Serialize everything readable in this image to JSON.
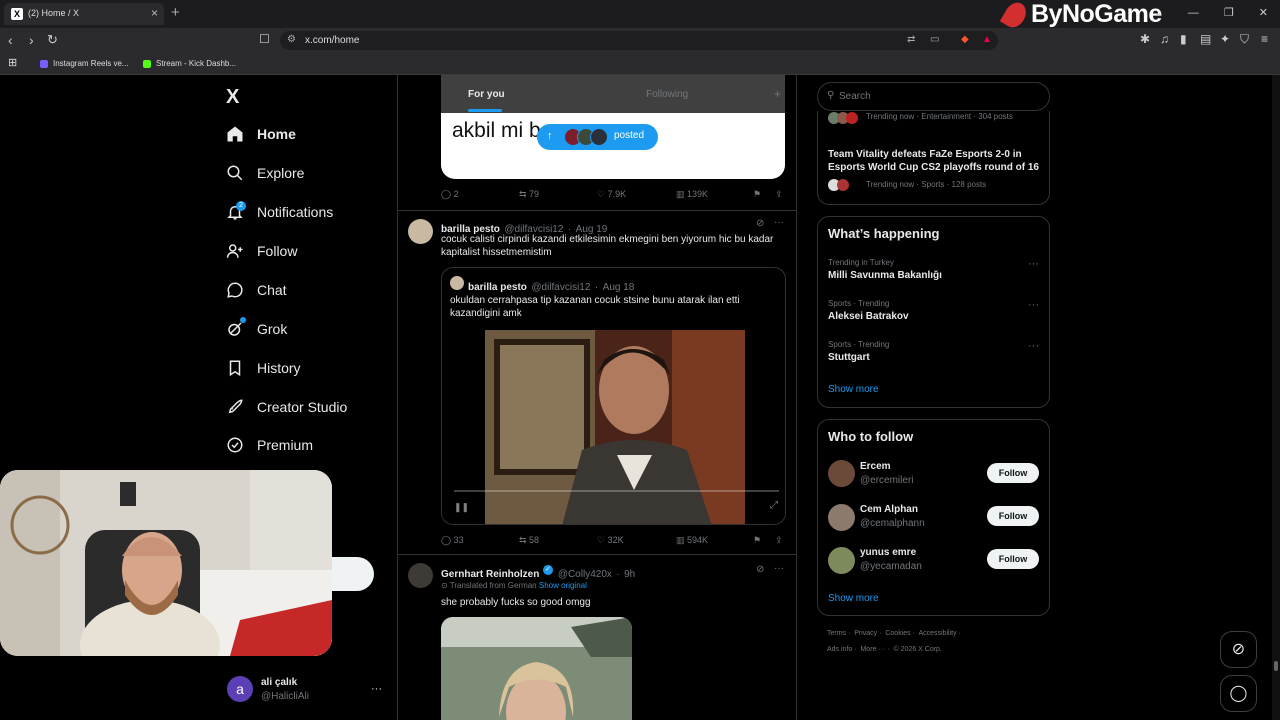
{
  "browser": {
    "tab_title": "(2) Home / X",
    "tab_favicon": "X",
    "url": "x.com/home",
    "brand": "ByNoGame",
    "bookmarks": [
      {
        "label": "Instagram Reels ve...",
        "color": "#7b5cff"
      },
      {
        "label": "Stream - Kick Dashb...",
        "color": "#53fc18"
      }
    ]
  },
  "nav": {
    "logo": "X",
    "items": [
      {
        "label": "Home",
        "icon": "home-icon"
      },
      {
        "label": "Explore",
        "icon": "search-icon"
      },
      {
        "label": "Notifications",
        "icon": "bell-icon",
        "badge": "2"
      },
      {
        "label": "Follow",
        "icon": "person-add-icon"
      },
      {
        "label": "Chat",
        "icon": "chat-icon"
      },
      {
        "label": "Grok",
        "icon": "grok-icon"
      },
      {
        "label": "History",
        "icon": "bookmark-icon"
      },
      {
        "label": "Creator Studio",
        "icon": "rocket-icon"
      },
      {
        "label": "Premium",
        "icon": "verified-icon"
      }
    ],
    "account": {
      "initial": "a",
      "name": "ali çalık",
      "handle": "@HalicliAli"
    }
  },
  "feed": {
    "tabs": {
      "for_you": "For you",
      "following": "Following"
    },
    "new_posts_pill": "posted",
    "top_card_text": "akbil mi b",
    "tweet0_actions": {
      "replies": "2",
      "reposts": "79",
      "likes": "7.9K",
      "views": "139K"
    },
    "tweet1": {
      "name": "barilla pesto",
      "handle": "@dilfavcisi12",
      "date": "Aug 19",
      "text": "cocuk calisti cirpindi kazandi etkilesimin ekmegini ben yiyorum hic bu kadar kapitalist hissetmemistim",
      "quote": {
        "name": "barilla pesto",
        "handle": "@dilfavcisi12",
        "date": "Aug 18",
        "text": "okuldan cerrahpasa tip kazanan cocuk stsine bunu atarak ilan etti kazandigini amk"
      },
      "actions": {
        "replies": "33",
        "reposts": "58",
        "likes": "32K",
        "views": "594K"
      }
    },
    "tweet2": {
      "name": "Gernhart Reinholzen",
      "handle": "@Colly420x",
      "date": "9h",
      "translated": "Translated from German",
      "show_original": "Show original",
      "text": "she probably fucks so good omgg"
    }
  },
  "sidebar": {
    "search_placeholder": "Search",
    "top_trends": [
      {
        "meta": "Trending now · Entertainment · 304 posts"
      },
      {
        "title": "Team Vitality defeats FaZe Esports 2-0 in Esports World Cup CS2 playoffs round of 16",
        "meta": "Trending now · Sports · 128 posts"
      }
    ],
    "happening": {
      "title": "What’s happening",
      "trends": [
        {
          "cat": "Trending in Turkey",
          "name": "Milli Savunma Bakanlığı"
        },
        {
          "cat": "Sports · Trending",
          "name": "Aleksei Batrakov"
        },
        {
          "cat": "Sports · Trending",
          "name": "Stuttgart"
        }
      ],
      "show_more": "Show more"
    },
    "who_to_follow": {
      "title": "Who to follow",
      "users": [
        {
          "name": "Ercem",
          "handle": "@ercemileri",
          "button": "Follow"
        },
        {
          "name": "Cem Alphan",
          "handle": "@cemalphann",
          "button": "Follow"
        },
        {
          "name": "yunus emre",
          "handle": "@yecamadan",
          "button": "Follow"
        }
      ],
      "show_more": "Show more"
    },
    "footer": {
      "row1": [
        "Terms",
        "Privacy",
        "Cookies",
        "Accessibility"
      ],
      "row2": [
        "Ads info",
        "More ···",
        "© 2026 X Corp."
      ]
    }
  }
}
